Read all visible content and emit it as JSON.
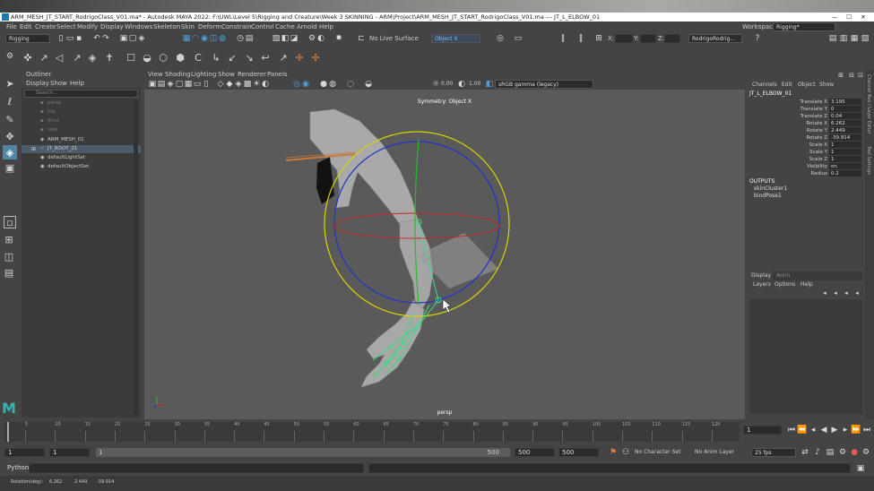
{
  "window": {
    "title": "ARM_MESH_JT_START_RodrigoClass_V01.ma* - Autodesk MAYA 2022: F:\\UWL\\Level 5\\Rigging and Creature\\Week 3 SKINNING - ARM\\Project\\ARM_MESH_JT_START_RodrigoClass_V01.ma --- JT_L_ELBOW_01",
    "controls": [
      "—",
      "☐",
      "✕"
    ]
  },
  "menu": [
    "File",
    "Edit",
    "Create",
    "Select",
    "Modify",
    "Display",
    "Windows",
    "Skeleton",
    "Skin",
    "Deform",
    "Constrain",
    "Control",
    "Cache",
    "Arnold",
    "Help"
  ],
  "workspace": {
    "label": "Workspace :",
    "value": "Rigging*"
  },
  "menuset": "Rigging",
  "live_surface": "No Live Surface",
  "symmetry_dropdown": "Object X",
  "xyz_labels": [
    "X:",
    "Y:",
    "Z:"
  ],
  "account": "RodrigoRodrig...",
  "outliner": {
    "title": "Outliner",
    "menu": [
      "Display",
      "Show",
      "Help"
    ],
    "search_placeholder": "Search...",
    "items": [
      {
        "label": "persp",
        "dim": true
      },
      {
        "label": "top",
        "dim": true
      },
      {
        "label": "front",
        "dim": true
      },
      {
        "label": "side",
        "dim": true
      },
      {
        "label": "ARM_MESH_01",
        "dim": false
      },
      {
        "label": "JT_ROOT_01",
        "dim": false
      },
      {
        "label": "defaultLightSet",
        "dim": false
      },
      {
        "label": "defaultObjectSet",
        "dim": false
      }
    ]
  },
  "viewport": {
    "menu": [
      "View",
      "Shading",
      "Lighting",
      "Show",
      "Renderer",
      "Panels"
    ],
    "exposure": "0.00",
    "gamma": "1.00",
    "colorspace": "sRGB gamma (legacy)",
    "symmetry_label": "Symmetry: Object X",
    "camera_label": "persp",
    "colors": {
      "rotate_ring": "#d8d400",
      "x_ring": "#cc2222",
      "y_ring": "#22c022",
      "z_ring": "#2233cc",
      "joints": "#3ddc84"
    }
  },
  "channels": {
    "menu": [
      "Channels",
      "Edit",
      "Object",
      "Show"
    ],
    "object": "JT_L_ELBOW_01",
    "rows": [
      {
        "label": "Translate X",
        "value": "3.195"
      },
      {
        "label": "Translate Y",
        "value": "0"
      },
      {
        "label": "Translate Z",
        "value": "0.04"
      },
      {
        "label": "Rotate X",
        "value": "6.262"
      },
      {
        "label": "Rotate Y",
        "value": "2.449"
      },
      {
        "label": "Rotate Z",
        "value": "-39.914"
      },
      {
        "label": "Scale X",
        "value": "1"
      },
      {
        "label": "Scale Y",
        "value": "1"
      },
      {
        "label": "Scale Z",
        "value": "1"
      },
      {
        "label": "Visibility",
        "value": "on"
      },
      {
        "label": "Radius",
        "value": "0.2"
      }
    ],
    "outputs_label": "OUTPUTS",
    "outputs": [
      "skinCluster1",
      "bindPose1"
    ]
  },
  "layers": {
    "tabs": [
      "Display",
      "Anim"
    ],
    "menu": [
      "Layers",
      "Options",
      "Help"
    ]
  },
  "side_tabs": [
    "Channel Box / Layer Editor",
    "Tool Settings"
  ],
  "timeline": {
    "ticks": [
      "5",
      "10",
      "15",
      "20",
      "25",
      "30",
      "35",
      "40",
      "45",
      "50",
      "55",
      "60",
      "65",
      "70",
      "75",
      "80",
      "85",
      "90",
      "95",
      "100",
      "105",
      "110",
      "115",
      "120"
    ],
    "current_frame": "1"
  },
  "range": {
    "start": "1",
    "playback_start": "1",
    "slider_label": "1",
    "slider_end": "500",
    "playback_end": "500",
    "end": "500",
    "character_set": "No Character Set",
    "anim_layer": "No Anim Layer",
    "fps": "25 fps"
  },
  "cmdline": {
    "language": "Python"
  },
  "helpline": {
    "text": "Rotation(deg):",
    "values": [
      "6.262",
      "2.449",
      "-39.914"
    ]
  }
}
